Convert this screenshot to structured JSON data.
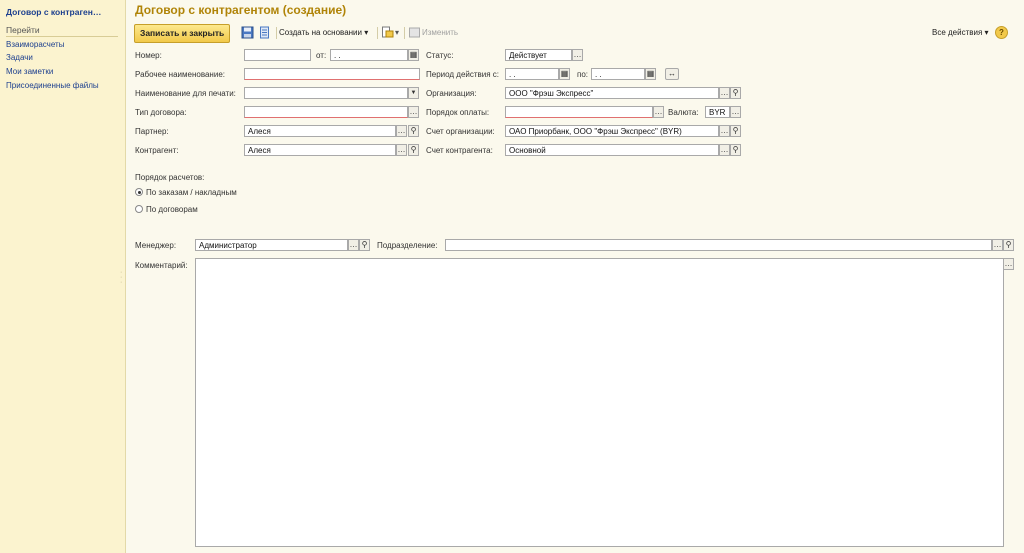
{
  "sidebar": {
    "title": "Договор с контраген…",
    "section": "Перейти",
    "items": [
      {
        "label": "Взаиморасчеты"
      },
      {
        "label": "Задачи"
      },
      {
        "label": "Мои заметки"
      },
      {
        "label": "Присоединенные файлы"
      }
    ]
  },
  "page_title": "Договор с контрагентом (создание)",
  "toolbar": {
    "save_close": "Записать и закрыть",
    "create_based": "Создать на основании",
    "edit": "Изменить",
    "all_actions": "Все действия",
    "help": "?"
  },
  "form": {
    "number_label": "Номер:",
    "number_value": "",
    "from_label": "от:",
    "from_value": " .  .",
    "status_label": "Статус:",
    "status_value": "Действует",
    "work_name_label": "Рабочее наименование:",
    "work_name_value": "",
    "period_label": "Период действия с:",
    "period_from": " .  .",
    "period_to_label": "по:",
    "period_to": " .  .",
    "print_name_label": "Наименование для печати:",
    "print_name_value": "",
    "org_label": "Организация:",
    "org_value": "ООО \"Фрэш Экспресс\"",
    "contract_type_label": "Тип договора:",
    "contract_type_value": "",
    "payment_order_label": "Порядок оплаты:",
    "payment_order_value": "",
    "currency_label": "Валюта:",
    "currency_value": "BYR",
    "partner_label": "Партнер:",
    "partner_value": "Алеся",
    "org_account_label": "Счет организации:",
    "org_account_value": "ОАО Приорбанк, ООО \"Фрэш Экспресс\" (BYR)",
    "counterparty_label": "Контрагент:",
    "counterparty_value": "Алеся",
    "cp_account_label": "Счет контрагента:",
    "cp_account_value": "Основной",
    "settlement_label": "Порядок расчетов:",
    "settlement_options": [
      {
        "label": "По заказам / накладным",
        "checked": true
      },
      {
        "label": "По договорам",
        "checked": false
      }
    ],
    "manager_label": "Менеджер:",
    "manager_value": "Администратор",
    "department_label": "Подразделение:",
    "department_value": "",
    "comment_label": "Комментарий:",
    "comment_value": ""
  },
  "colors": {
    "accent": "#b08408",
    "link": "#1c3f8f",
    "sidebar_bg": "#fbf3cf",
    "main_bg": "#fbf9ed",
    "primary_button": "#f2c94a"
  }
}
